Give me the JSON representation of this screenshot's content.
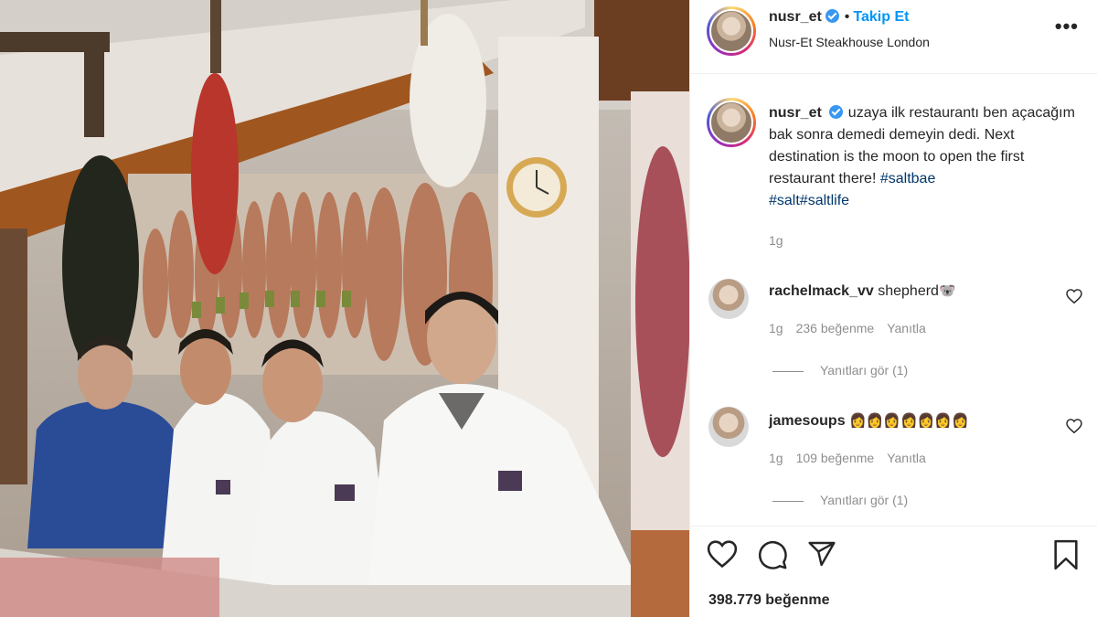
{
  "post": {
    "username": "nusr_et",
    "follow_label": "Takip Et",
    "separator": "•",
    "location": "Nusr-Et Steakhouse London",
    "more_icon": "more-horizontal-icon"
  },
  "caption": {
    "username": "nusr_et",
    "text": "uzaya ilk restaurantı ben açacağım bak sonra demedi demeyin dedi. Next destination is the moon to open the first restaurant there! ",
    "hashtags": [
      "#saltbae",
      "#salt",
      "#saltlife"
    ],
    "time": "1g"
  },
  "comments": [
    {
      "username": "rachelmack_vv",
      "text": "shepherd",
      "emoji": "🐨",
      "time": "1g",
      "likes": "236 beğenme",
      "reply": "Yanıtla",
      "view_replies": "Yanıtları gör (1)"
    },
    {
      "username": "jamesoups",
      "text": "",
      "emoji": "👩‍👩‍👩‍👩‍👩‍👩‍👩",
      "time": "1g",
      "likes": "109 beğenme",
      "reply": "Yanıtla",
      "view_replies": "Yanıtları gör (1)"
    }
  ],
  "actions": {
    "like_icon": "heart-icon",
    "comment_icon": "comment-icon",
    "share_icon": "send-icon",
    "save_icon": "bookmark-icon"
  },
  "likes_count": "398.779 beğenme",
  "colors": {
    "link_blue": "#0095f6",
    "hashtag": "#00376b",
    "verified": "#3897f0",
    "muted": "#8e8e8e"
  }
}
